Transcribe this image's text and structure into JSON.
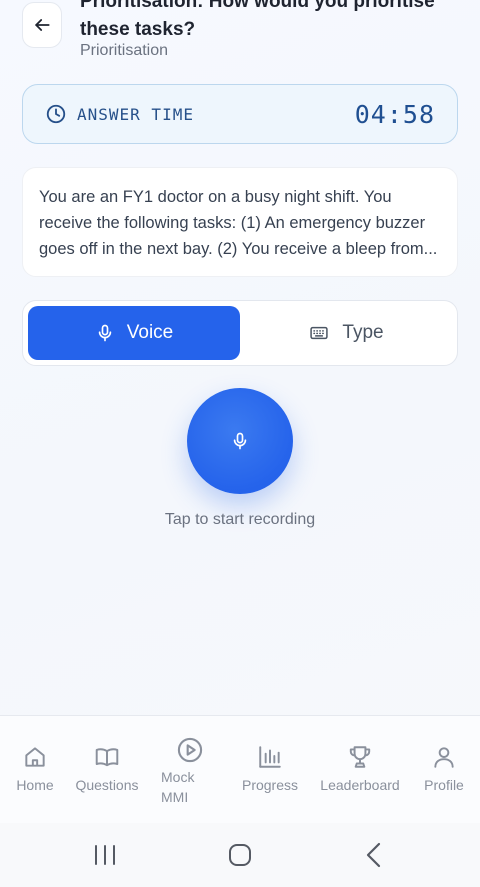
{
  "header": {
    "title": "Prioritisation: How would you prioritise these tasks?",
    "subtitle": "Prioritisation"
  },
  "timer": {
    "label": "ANSWER TIME",
    "value": "04:58"
  },
  "scenario": {
    "text": "You are an FY1 doctor on a busy night shift. You receive the following tasks: (1) An emergency buzzer goes off in the next bay. (2) You receive a bleep from..."
  },
  "mode_toggle": {
    "voice_label": "Voice",
    "type_label": "Type",
    "selected": "Voice"
  },
  "recorder": {
    "hint": "Tap to start recording"
  },
  "bottom_nav": {
    "items": [
      {
        "label": "Home",
        "icon": "home-icon"
      },
      {
        "label": "Questions",
        "icon": "book-icon"
      },
      {
        "label": "Mock MMI",
        "icon": "play-circle-icon"
      },
      {
        "label": "Progress",
        "icon": "bar-chart-icon"
      },
      {
        "label": "Leaderboard",
        "icon": "trophy-icon"
      },
      {
        "label": "Profile",
        "icon": "user-icon"
      }
    ]
  },
  "colors": {
    "accent": "#2563eb",
    "timer_text": "#1f4f91",
    "nav_inactive": "#8a909c"
  }
}
